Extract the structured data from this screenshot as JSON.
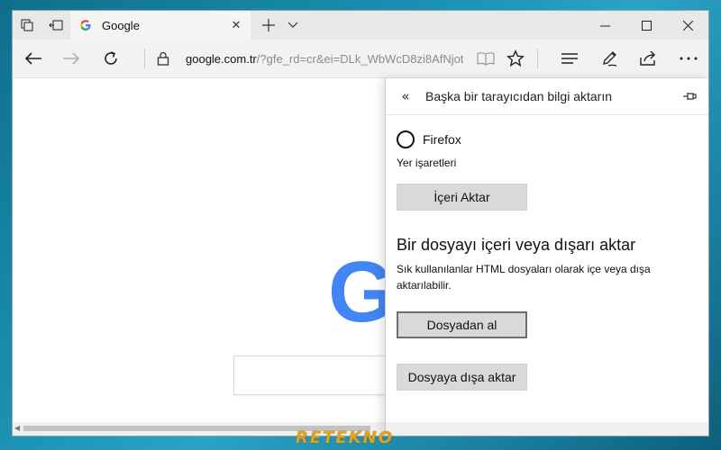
{
  "browser": {
    "tab": {
      "title": "Google"
    },
    "address": {
      "host": "google.com.tr",
      "path": "/?gfe_rd=cr&ei=DLk_WbWcD8zi8AfNjot"
    }
  },
  "panel": {
    "title": "Başka bir tarayıcıdan bilgi aktarın",
    "source_option": "Firefox",
    "source_detail": "Yer işaretleri",
    "import_button": "İçeri Aktar",
    "section_title": "Bir dosyayı içeri veya dışarı aktar",
    "section_desc": "Sık kullanılanlar HTML dosyaları olarak içe veya dışa aktarılabilir.",
    "from_file_button": "Dosyadan al",
    "to_file_button": "Dosyaya dışa aktar"
  },
  "page": {
    "logo_letter": "G"
  },
  "watermark": "RETEKNO",
  "colors": {
    "google_blue": "#4285f4",
    "watermark": "#e2a21b",
    "button_bg": "#d9d9d9"
  }
}
